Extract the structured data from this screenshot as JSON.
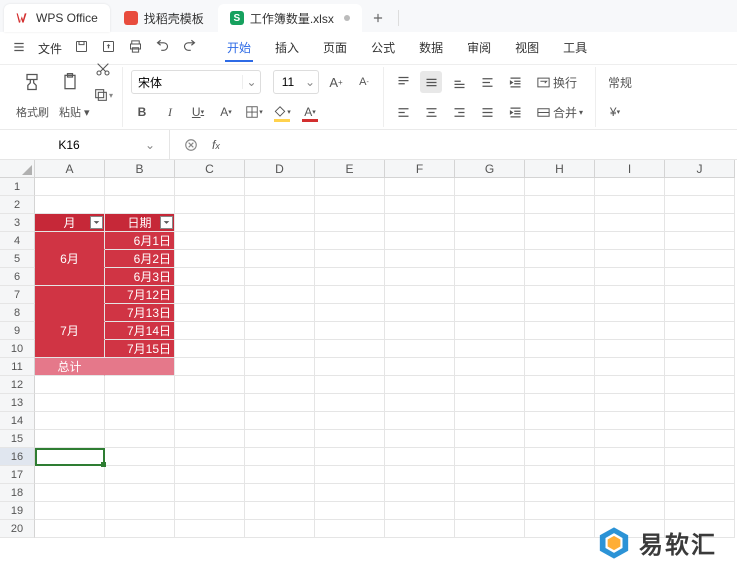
{
  "tabs": {
    "app": "WPS Office",
    "template": "找稻壳模板",
    "doc": "工作簿数量.xlsx"
  },
  "menubar": {
    "file": "文件",
    "items": [
      "开始",
      "插入",
      "页面",
      "公式",
      "数据",
      "审阅",
      "视图",
      "工具"
    ],
    "activeIndex": 0
  },
  "ribbon": {
    "format_painter": "格式刷",
    "paste": "粘贴",
    "font_name": "宋体",
    "font_size": "11",
    "wrap": "换行",
    "merge": "合并",
    "style": "常规"
  },
  "fx": {
    "cell_ref": "K16",
    "formula": ""
  },
  "grid": {
    "cols": [
      "A",
      "B",
      "C",
      "D",
      "E",
      "F",
      "G",
      "H",
      "I",
      "J"
    ],
    "rowCount": 20,
    "selectedRow": 16,
    "headers": {
      "month": "月",
      "date": "日期"
    },
    "monthA": "6月",
    "monthB": "7月",
    "dates": [
      "6月1日",
      "6月2日",
      "6月3日",
      "7月12日",
      "7月13日",
      "7月14日",
      "7月15日"
    ],
    "total": "总计"
  },
  "watermark": "易软汇"
}
